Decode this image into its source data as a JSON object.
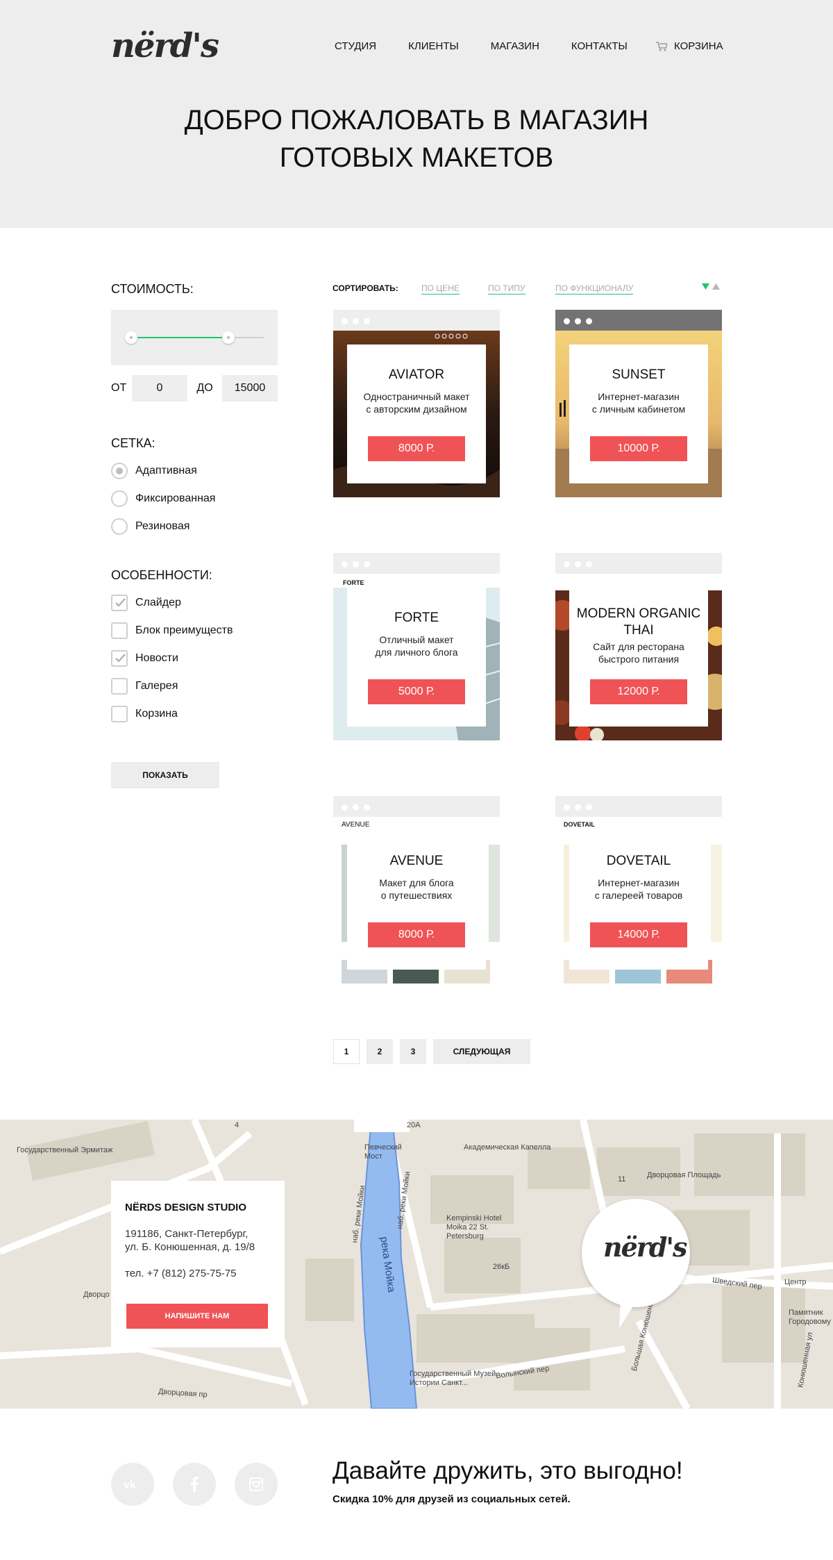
{
  "header": {
    "logo": "nërd's",
    "nav": [
      "СТУДИЯ",
      "КЛИЕНТЫ",
      "МАГАЗИН",
      "КОНТАКТЫ"
    ],
    "cart_label": "КОРЗИНА",
    "title_line1": "ДОБРО ПОЖАЛОВАТЬ В МАГАЗИН",
    "title_line2": "ГОТОВЫХ МАКЕТОВ"
  },
  "filters": {
    "price_heading": "СТОИМОСТЬ:",
    "range": {
      "from_label": "ОТ",
      "from_value": "0",
      "to_label": "ДО",
      "to_value": "15000"
    },
    "grid_heading": "СЕТКА:",
    "grid_options": [
      {
        "label": "Адаптивная",
        "selected": true
      },
      {
        "label": "Фиксированная",
        "selected": false
      },
      {
        "label": "Резиновая",
        "selected": false
      }
    ],
    "features_heading": "ОСОБЕННОСТИ:",
    "features": [
      {
        "label": "Слайдер",
        "checked": true
      },
      {
        "label": "Блок преимуществ",
        "checked": false
      },
      {
        "label": "Новости",
        "checked": true
      },
      {
        "label": "Галерея",
        "checked": false
      },
      {
        "label": "Корзина",
        "checked": false
      }
    ],
    "show_button": "ПОКАЗАТЬ"
  },
  "sort": {
    "label": "СОРТИРОВАТЬ:",
    "links": [
      "ПО ЦЕНЕ",
      "ПО ТИПУ",
      "ПО ФУНКЦИОНАЛУ"
    ]
  },
  "products": [
    {
      "name": "AVIATOR",
      "desc_line1": "Одностраничный макет",
      "desc_line2": "с авторским дизайном",
      "price": "8000 Р."
    },
    {
      "name": "SUNSET",
      "desc_line1": "Интернет-магазин",
      "desc_line2": "с личным кабинетом",
      "price": "10000 Р."
    },
    {
      "name": "FORTE",
      "desc_line1": "Отличный макет",
      "desc_line2": "для личного блога",
      "price": "5000 Р."
    },
    {
      "name": "MODERN ORGANIC THAI",
      "desc_line1": "Сайт для ресторана",
      "desc_line2": "быстрого питания",
      "price": "12000 Р."
    },
    {
      "name": "AVENUE",
      "desc_line1": "Макет для блога",
      "desc_line2": "о путешествиях",
      "price": "8000 Р."
    },
    {
      "name": "DOVETAIL",
      "desc_line1": "Интернет-магазин",
      "desc_line2": "с галереей товаров",
      "price": "14000 Р."
    }
  ],
  "pagination": {
    "pages": [
      "1",
      "2",
      "3"
    ],
    "next": "СЛЕДУЮЩАЯ"
  },
  "contact": {
    "title": "NËRDS DESIGN STUDIO",
    "addr_line1": "191186, Санкт-Петербург,",
    "addr_line2": "ул. Б. Конюшенная, д. 19/8",
    "tel": "тел. +7 (812) 275-75-75",
    "button": "НАПИШИТЕ НАМ",
    "pin_logo": "nërd's"
  },
  "map_labels": {
    "hermitage": "Государственный Эрмитаж",
    "pevchesky": "Певческий Мост",
    "kapella": "Академическая Капелла",
    "dvortsovaya_sq": "Дворцовая Площадь",
    "kempinski": "Kempinski Hotel Moika 22 St. Petersburg",
    "moika": "река Мойка",
    "nab1": "наб. реки Мойки",
    "nab2": "наб. реки Мойки",
    "volynsky": "Волынский пер",
    "shvedsky": "Шведский пер",
    "bolshaya_kon": "Большая Конюшенная",
    "center": "Центр",
    "pamyatnik": "Памятник Городовому",
    "museum": "Государственный Музей Истории Санкт...",
    "dvortsovaya_pr": "Дворцовая пр",
    "dvorts": "Дворцо",
    "kon_ul": "Конюшенная ул",
    "d20a": "20А",
    "d4": "4",
    "d11": "11",
    "d26kb": "26кБ"
  },
  "social": {
    "icons": [
      "vk-icon",
      "facebook-icon",
      "instagram-icon"
    ],
    "title": "Давайте дружить, это выгодно!",
    "subtitle": "Скидка 10% для друзей из социальных сетей."
  },
  "colors": {
    "accent": "#f05356",
    "green": "#1fc36f",
    "header_bg": "#ededed"
  }
}
